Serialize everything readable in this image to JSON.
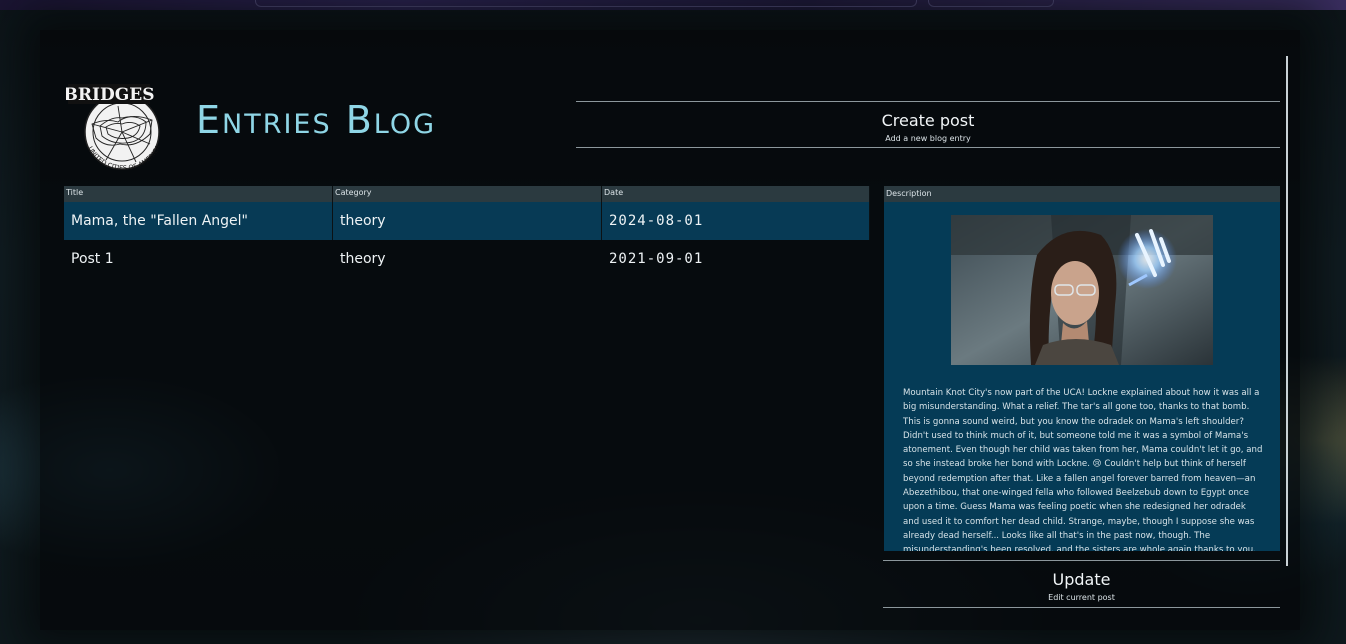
{
  "header": {
    "logo_text": "BRIDGES",
    "logo_ring_text": "UNITED CITIES OF AMERICA",
    "title": "Entries Blog"
  },
  "actions": {
    "create": {
      "label": "Create post",
      "sub": "Add a new blog entry"
    },
    "update": {
      "label": "Update",
      "sub": "Edit current post"
    }
  },
  "table": {
    "columns": [
      "Title",
      "Category",
      "Date"
    ],
    "rows": [
      {
        "title": "Mama, the \"Fallen Angel\"",
        "category": "theory",
        "date": "2024-08-01",
        "selected": true
      },
      {
        "title": "Post 1",
        "category": "theory",
        "date": "2021-09-01",
        "selected": false
      }
    ]
  },
  "description": {
    "header": "Description",
    "text": "Mountain Knot City's now part of the UCA! Lockne explained about how it was all a big misunderstanding. What a relief. The tar's all gone too, thanks to that bomb. This is gonna sound weird, but you know the odradek on Mama's left shoulder? Didn't used to think much of it, but someone told me it was a symbol of Mama's atonement. Even though her child was taken from her, Mama couldn't let it go, and so she instead broke her bond with Lockne. 😢 Couldn't help but think of herself beyond redemption after that. Like a fallen angel forever barred from heaven—an Abezethibou, that one-winged fella who followed Beelzebub down to Egypt once upon a time. Guess Mama was feeling poetic when she redesigned her odradek and used it to comfort her dead child. Strange, maybe, though I suppose she was already dead herself... Looks like all that's in the past now, though. The misunderstanding's been resolved, and the sisters are whole again thanks to you."
  },
  "colors": {
    "accent_title": "#8fd6e6",
    "selected_row": "#073a55",
    "header_bg": "#2b3a40",
    "description_bg": "#053b56"
  }
}
